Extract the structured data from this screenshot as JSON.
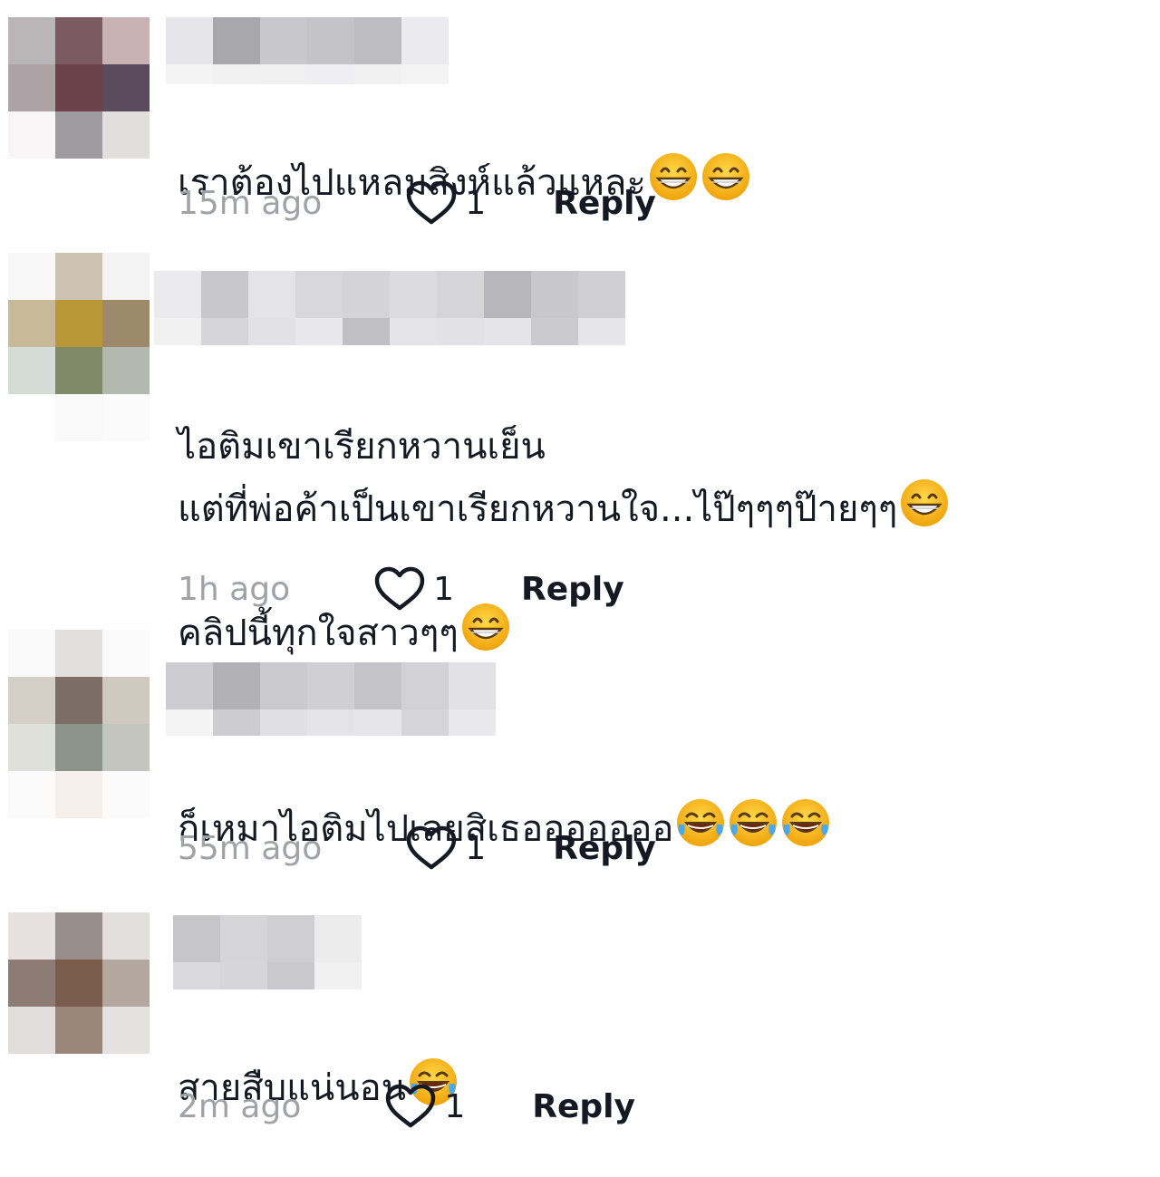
{
  "comments": [
    {
      "avatar_colors": [
        "#b9b6b8",
        "#7b5a61",
        "#c9b2b4",
        "#ada2a6",
        "#6b4249",
        "#5b4c5d",
        "#f7f5f5",
        "#9f9a9f",
        "#e2dede"
      ],
      "username_colors": [
        "#e6e6e8",
        "#a8a8ab",
        "#c8c8cb",
        "#c4c4c8",
        "#bdbdc0",
        "#ebebed",
        "#f4f4f5",
        "#f1f1f2",
        "#f0f0f1",
        "#efeff1",
        "#f1f1f2",
        "#f4f4f5"
      ],
      "text": "เราต้องไปแหลมสิงห์แล้วแหละ",
      "emojis": [
        "grin-emoji",
        "grin-emoji"
      ],
      "time": "15m ago",
      "likes": "1",
      "reply": "Reply"
    },
    {
      "avatar_colors": [
        "#f8f8f8",
        "#ccc3b3",
        "#f2f3f2",
        "#c8b998",
        "#b99737",
        "#9d8a6a",
        "#d4dcd8",
        "#808a68",
        "#b5b8af",
        "#ffffff",
        "#f9f9f9",
        "#fbfbfb"
      ],
      "username_colors": [
        "#ebebed",
        "#c8c8cb",
        "#e4e4e6",
        "#d8d8da",
        "#d4d4d7",
        "#dcdcdf",
        "#d5d5d7",
        "#b7b7bb",
        "#c8c8cc",
        "#d0d0d3",
        "#f1f1f2",
        "#d5d5d8",
        "#e2e2e4",
        "#e8e8ea",
        "#c0c0c4",
        "#e4e4e6",
        "#e2e2e4",
        "#e5e5e7",
        "#cbcbce",
        "#e6e6e8"
      ],
      "text": "ไอติมเขาเรียกหวานเย็น\nแต่ที่พ่อค้าเป็นเขาเรียกหวานใจ...ไป๊ๆๆๆป๊ายๆๆ",
      "text_line3": "คลิปนี้ทุกใจสาวๆๆ",
      "emojis": [
        "grin-emoji"
      ],
      "emojis_line3": [
        "grin-emoji"
      ],
      "time": "1h ago",
      "likes": "1",
      "reply": "Reply"
    },
    {
      "avatar_colors": [
        "#fafafa",
        "#e2e0de",
        "#fbfbfb",
        "#d3cec6",
        "#7c6e66",
        "#cfc9c0",
        "#dfe0da",
        "#8d9489",
        "#c4c5be",
        "#fbfbfb",
        "#f4efeb",
        "#fbfbfb"
      ],
      "username_colors": [
        "#cdcdd0",
        "#b2b2b6",
        "#cbcbce",
        "#d0d0d3",
        "#c5c5c9",
        "#d2d2d5",
        "#e2e2e4",
        "#f4f4f5",
        "#cdcdd0",
        "#e0e0e2",
        "#e4e4e6",
        "#e6e6e8",
        "#d6d6d9",
        "#e9e9eb"
      ],
      "text": "ก็เหมาไอติมไปเลยสิเธอออออออ",
      "emojis": [
        "tears-joy-emoji",
        "tears-joy-emoji",
        "tears-joy-emoji"
      ],
      "time": "55m ago",
      "likes": "1",
      "reply": "Reply"
    },
    {
      "avatar_colors": [
        "#e6e1e0",
        "#978d8a",
        "#e2dfdc",
        "#8e7b73",
        "#7b5c4c",
        "#b3a7a0",
        "#e0dddc",
        "#9a8579",
        "#e3e2e1"
      ],
      "username_colors": [
        "#c6c6c9",
        "#d5d5d8",
        "#cfcfd2",
        "#ececed",
        "#dadadc",
        "#d6d6d9",
        "#c9c9cc",
        "#f1f1f2"
      ],
      "text": "สายสืบแน่นอน",
      "emojis": [
        "tears-joy-emoji"
      ],
      "time": "2m ago",
      "likes": "1",
      "reply": "Reply"
    }
  ]
}
